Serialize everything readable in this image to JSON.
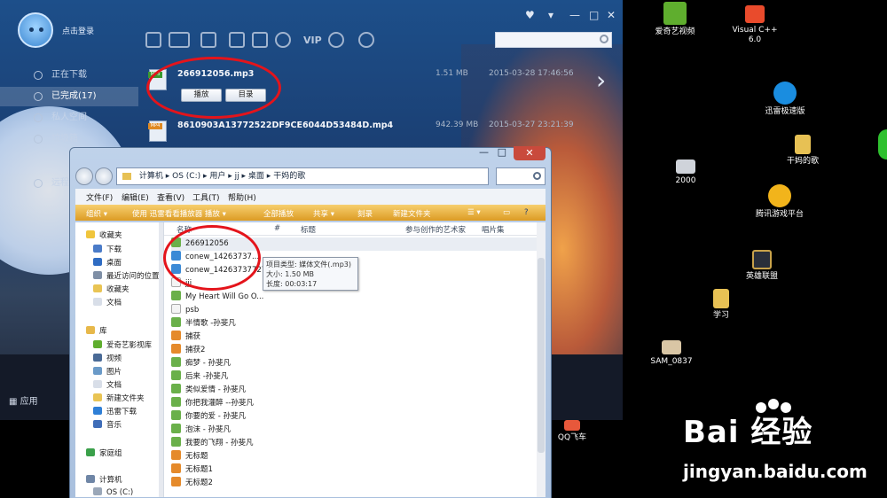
{
  "desktop": {
    "icons": [
      {
        "label": "爱奇艺视频",
        "color": "#5fae2e"
      },
      {
        "label": "Visual C++ 6.0",
        "color": "#e94b2c"
      },
      {
        "label": "迅雷极速版",
        "color": "#1a8de0"
      },
      {
        "label": "干妈的歌",
        "color": "#e7c154"
      },
      {
        "label": "2000",
        "color": "#cfd3da"
      },
      {
        "label": "腾讯游戏平台",
        "color": "#f2b41b"
      },
      {
        "label": "英雄联盟",
        "color": "#c8a24a"
      },
      {
        "label": "学习",
        "color": "#e7c154"
      },
      {
        "label": "SAM_0837",
        "color": "#d9c6a5"
      },
      {
        "label": "QQ飞车",
        "color": "#e7583b"
      }
    ],
    "partial_label": "全"
  },
  "xunlei": {
    "login_text": "点击登录",
    "sidebar": [
      {
        "label": "正在下载"
      },
      {
        "label": "已完成(17)"
      },
      {
        "label": "私人空间"
      },
      {
        "label": "垃圾箱"
      },
      {
        "label": "远程..."
      }
    ],
    "app_label": "应用",
    "vip_label": "VIP",
    "tasks": [
      {
        "name": "266912056.mp3",
        "type": "MP3",
        "tag_color": "#3a9a2f",
        "size": "1.51 MB",
        "date": "2015-03-28 17:46:56",
        "play": "播放",
        "dir": "目录"
      },
      {
        "name": "8610903A13772522DF9CE6044D53484D.mp4",
        "type": "MP4",
        "tag_color": "#e08a22",
        "size": "942.39 MB",
        "date": "2015-03-27 23:21:39"
      }
    ],
    "next_arrow": "›"
  },
  "explorer": {
    "path": [
      "计算机",
      "OS (C:)",
      "用户",
      "jj",
      "桌面",
      "干妈的歌"
    ],
    "menu": [
      "文件(F)",
      "编辑(E)",
      "查看(V)",
      "工具(T)",
      "帮助(H)"
    ],
    "commands": [
      "组织 ▾",
      "使用 迅雷看看播放器 播放 ▾",
      "全部播放",
      "共享 ▾",
      "刻录",
      "新建文件夹"
    ],
    "nav": {
      "favorites": "收藏夹",
      "favorite_items": [
        "下载",
        "桌面",
        "最近访问的位置",
        "收藏夹",
        "文档"
      ],
      "libraries": "库",
      "library_items": [
        "爱奇艺影视库",
        "视频",
        "图片",
        "文档",
        "新建文件夹",
        "迅雷下载",
        "音乐"
      ],
      "homegroup": "家庭组",
      "computer": "计算机",
      "drive": "OS (C:)"
    },
    "columns": [
      "名称",
      "#",
      "标题",
      "参与创作的艺术家",
      "唱片集"
    ],
    "files": [
      {
        "name": "266912056",
        "color": "#6ab04a"
      },
      {
        "name": "conew_14263737...",
        "color": "#3b8ad6"
      },
      {
        "name": "conew_14263737727",
        "color": "#3b8ad6"
      },
      {
        "name": "jjj",
        "color": "#f4f4f4"
      },
      {
        "name": "My Heart Will Go O...",
        "color": "#6ab04a"
      },
      {
        "name": "psb",
        "color": "#f4f4f4"
      },
      {
        "name": "半情歌 -孙斐凡",
        "color": "#6ab04a"
      },
      {
        "name": "捕获",
        "color": "#e58a2b"
      },
      {
        "name": "捕获2",
        "color": "#e58a2b"
      },
      {
        "name": "痴梦 - 孙斐凡",
        "color": "#6ab04a"
      },
      {
        "name": "后来 -孙斐凡",
        "color": "#6ab04a"
      },
      {
        "name": "类似爱情 - 孙斐凡",
        "color": "#6ab04a"
      },
      {
        "name": "你把我灌醉 --孙斐凡",
        "color": "#6ab04a"
      },
      {
        "name": "你要的爱 - 孙斐凡",
        "color": "#6ab04a"
      },
      {
        "name": "泡沫 - 孙斐凡",
        "color": "#6ab04a"
      },
      {
        "name": "我要的飞翔 - 孙斐凡",
        "color": "#6ab04a"
      },
      {
        "name": "无标题",
        "color": "#e58a2b"
      },
      {
        "name": "无标题1",
        "color": "#e58a2b"
      },
      {
        "name": "无标题2",
        "color": "#e58a2b"
      }
    ],
    "tooltip": [
      "项目类型: 媒体文件(.mp3)",
      "大小: 1.50 MB",
      "长度: 00:03:17"
    ]
  },
  "watermark": {
    "logo": "Bai 经验",
    "url": "jingyan.baidu.com"
  }
}
